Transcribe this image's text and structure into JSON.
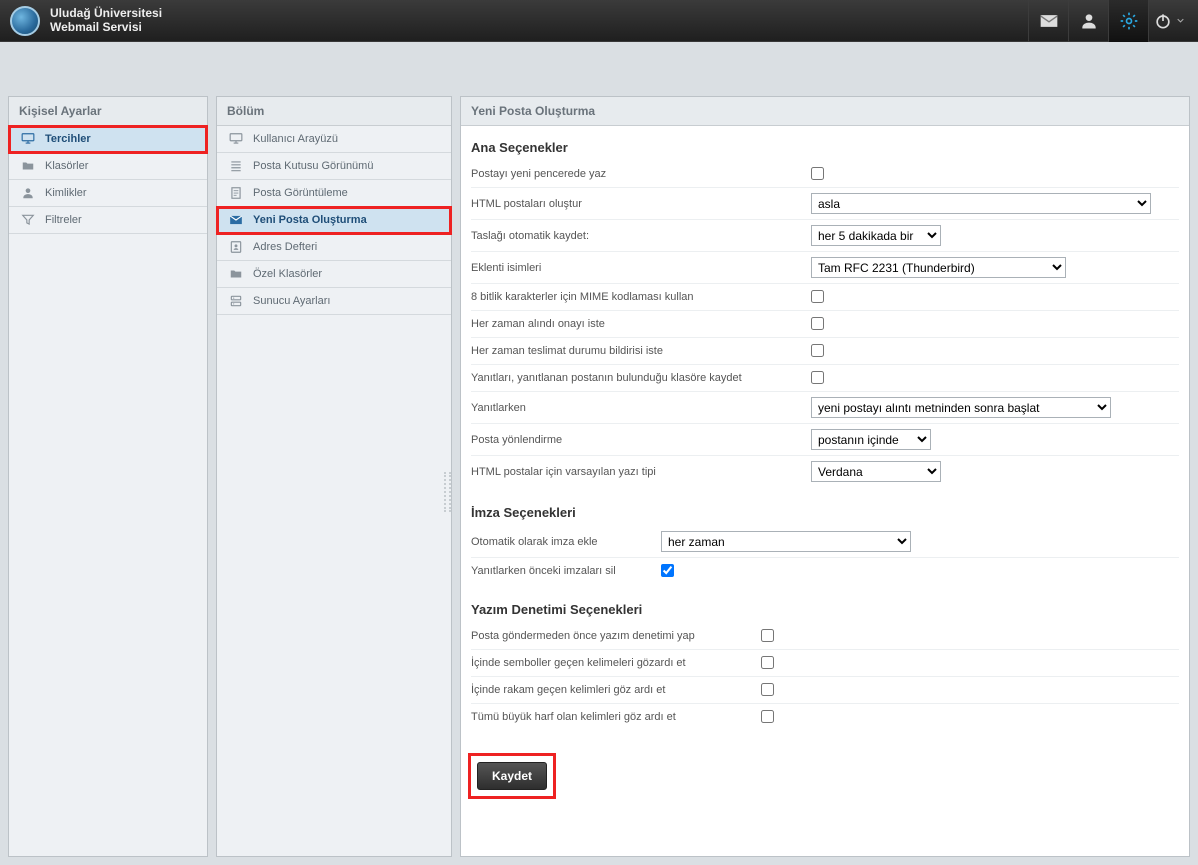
{
  "brand": {
    "line1": "Uludağ Üniversitesi",
    "line2": "Webmail Servisi"
  },
  "left_panel": {
    "title": "Kişisel Ayarlar",
    "items": [
      {
        "label": "Tercihler",
        "icon": "monitor-icon",
        "selected": true,
        "highlight": true
      },
      {
        "label": "Klasörler",
        "icon": "folder-icon"
      },
      {
        "label": "Kimlikler",
        "icon": "user-icon"
      },
      {
        "label": "Filtreler",
        "icon": "funnel-icon"
      }
    ]
  },
  "section_panel": {
    "title": "Bölüm",
    "items": [
      {
        "label": "Kullanıcı Arayüzü",
        "icon": "monitor-icon"
      },
      {
        "label": "Posta Kutusu Görünümü",
        "icon": "list-icon"
      },
      {
        "label": "Posta Görüntüleme",
        "icon": "page-icon"
      },
      {
        "label": "Yeni Posta Oluşturma",
        "icon": "mail-icon",
        "selected": true,
        "highlight": true
      },
      {
        "label": "Adres Defteri",
        "icon": "addressbook-icon"
      },
      {
        "label": "Özel Klasörler",
        "icon": "folder-icon"
      },
      {
        "label": "Sunucu Ayarları",
        "icon": "server-icon"
      }
    ]
  },
  "main": {
    "title": "Yeni Posta Oluşturma",
    "groups": [
      {
        "id": "main-options",
        "title": "Ana Seçenekler",
        "rows": [
          {
            "label": "Postayı yeni pencerede yaz",
            "type": "checkbox",
            "checked": false
          },
          {
            "label": "HTML postaları oluştur",
            "type": "select",
            "value": "asla",
            "width": "wide1"
          },
          {
            "label": "Taslağı otomatik kaydet:",
            "type": "select",
            "value": "her 5 dakikada bir",
            "width": "wide2"
          },
          {
            "label": "Eklenti isimleri",
            "type": "select",
            "value": "Tam RFC 2231 (Thunderbird)",
            "width": "wide3"
          },
          {
            "label": "8 bitlik karakterler için MIME kodlaması kullan",
            "type": "checkbox",
            "checked": false
          },
          {
            "label": "Her zaman alındı onayı iste",
            "type": "checkbox",
            "checked": false
          },
          {
            "label": "Her zaman teslimat durumu bildirisi iste",
            "type": "checkbox",
            "checked": false
          },
          {
            "label": "Yanıtları, yanıtlanan postanın bulunduğu klasöre kaydet",
            "type": "checkbox",
            "checked": false
          },
          {
            "label": "Yanıtlarken",
            "type": "select",
            "value": "yeni postayı alıntı metninden sonra başlat",
            "width": "wide4"
          },
          {
            "label": "Posta yönlendirme",
            "type": "select",
            "value": "postanın içinde",
            "width": "wide5"
          },
          {
            "label": "HTML postalar için varsayılan yazı tipi",
            "type": "select",
            "value": "Verdana",
            "width": "wide6"
          }
        ]
      },
      {
        "id": "signature-options",
        "title": "İmza Seçenekleri",
        "class": "group-signature",
        "rows": [
          {
            "label": "Otomatik olarak imza ekle",
            "type": "select",
            "value": "her zaman",
            "width": "wide7"
          },
          {
            "label": "Yanıtlarken önceki imzaları sil",
            "type": "checkbox",
            "checked": true
          }
        ]
      },
      {
        "id": "spell-options",
        "title": "Yazım Denetimi Seçenekleri",
        "class": "group-spell",
        "rows": [
          {
            "label": "Posta göndermeden önce yazım denetimi yap",
            "type": "checkbox",
            "checked": false
          },
          {
            "label": "İçinde semboller geçen kelimeleri gözardı et",
            "type": "checkbox",
            "checked": false
          },
          {
            "label": "İçinde rakam geçen kelimleri göz ardı et",
            "type": "checkbox",
            "checked": false
          },
          {
            "label": "Tümü büyük harf olan kelimleri göz ardı et",
            "type": "checkbox",
            "checked": false
          }
        ]
      }
    ],
    "save_label": "Kaydet"
  }
}
